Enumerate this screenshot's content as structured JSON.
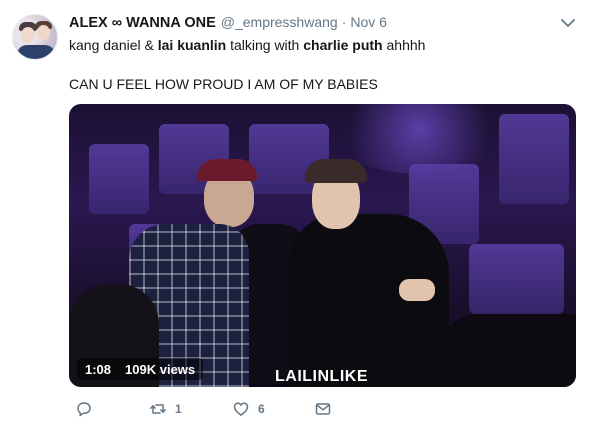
{
  "tweet": {
    "author": {
      "display_name": "ALEX ∞ WANNA ONE",
      "handle": "@_empresshwang",
      "separator": "·",
      "date": "Nov 6"
    },
    "text": {
      "line1": [
        {
          "text": "kang daniel & ",
          "bold": false
        },
        {
          "text": "lai kuanlin",
          "bold": true
        },
        {
          "text": " talking with ",
          "bold": false
        },
        {
          "text": "charlie puth",
          "bold": true
        },
        {
          "text": " ahhhh",
          "bold": false
        }
      ],
      "line2": "CAN U FEEL HOW PROUD I AM OF MY BABIES"
    },
    "media": {
      "type": "video",
      "duration": "1:08",
      "views": "109K views",
      "watermark": "LAILINLIKE"
    },
    "actions": {
      "reply_icon": "reply-icon",
      "retweet_icon": "retweet-icon",
      "retweet_count": "1",
      "like_icon": "heart-icon",
      "like_count": "6",
      "dm_icon": "envelope-icon"
    }
  },
  "colors": {
    "text_primary": "#14171a",
    "text_secondary": "#657786",
    "icon": "#657786"
  }
}
